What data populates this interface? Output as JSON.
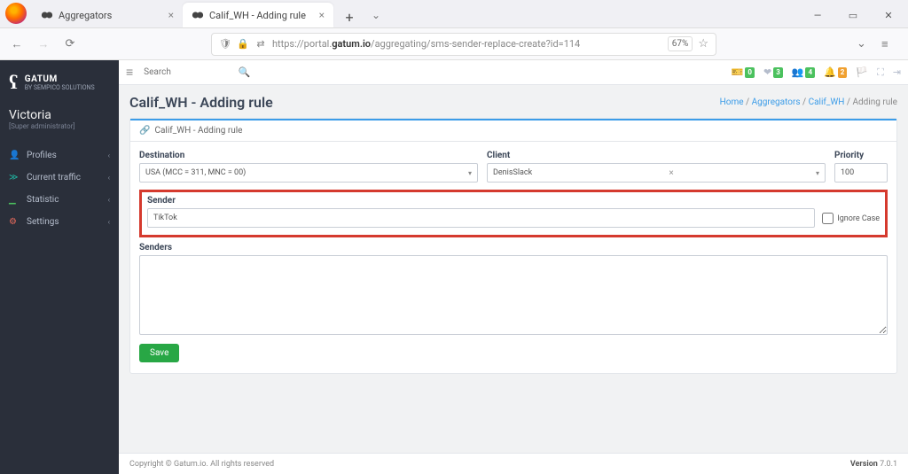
{
  "browser": {
    "tabs": [
      {
        "label": "Aggregators",
        "active": false
      },
      {
        "label": "Calif_WH - Adding rule",
        "active": true
      }
    ],
    "url_prefix": "https://portal.",
    "url_host": "gatum.io",
    "url_path": "/aggregating/sms-sender-replace-create?id=114",
    "zoom": "67%"
  },
  "brand": {
    "title": "GATUM",
    "subtitle": "BY SEMPICO SOLUTIONS"
  },
  "user": {
    "name": "Victoria",
    "role": "[Super administrator]"
  },
  "nav": {
    "profiles": "Profiles",
    "traffic": "Current traffic",
    "statistic": "Statistic",
    "settings": "Settings"
  },
  "topbar": {
    "search_placeholder": "Search",
    "badge1": "0",
    "badge2": "3",
    "badge3": "4",
    "badge4": "2"
  },
  "page": {
    "title": "Calif_WH - Adding rule",
    "panel_title": "Calif_WH - Adding rule"
  },
  "breadcrumb": {
    "home": "Home",
    "agg": "Aggregators",
    "calif": "Calif_WH",
    "current": "Adding rule"
  },
  "form": {
    "destination_label": "Destination",
    "destination_value": "USA (MCC = 311, MNC = 00)",
    "client_label": "Client",
    "client_value": "DenisSlack",
    "priority_label": "Priority",
    "priority_value": "100",
    "sender_label": "Sender",
    "sender_value": "TikTok",
    "ignore_label": "Ignore Case",
    "senders_label": "Senders",
    "senders_value": "",
    "save": "Save"
  },
  "footer": {
    "copy": "Copyright © Gatum.io. All rights reserved",
    "version_label": "Version",
    "version": "7.0.1"
  }
}
